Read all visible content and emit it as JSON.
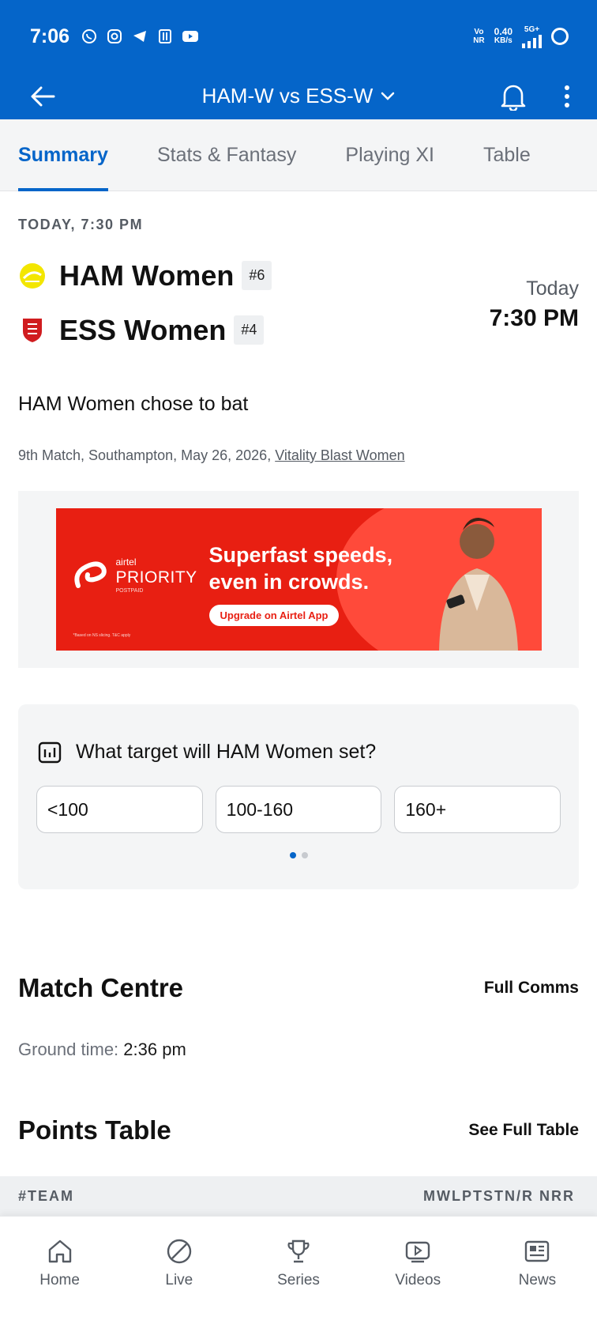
{
  "status_bar": {
    "time": "7:06",
    "volte_top": "Vo",
    "volte_bottom": "NR",
    "speed_value": "0.40",
    "speed_unit": "KB/s",
    "network": "5G+"
  },
  "header": {
    "title": "HAM-W vs ESS-W"
  },
  "tabs": [
    {
      "label": "Summary",
      "active": true
    },
    {
      "label": "Stats & Fantasy",
      "active": false
    },
    {
      "label": "Playing XI",
      "active": false
    },
    {
      "label": "Table",
      "active": false
    }
  ],
  "match": {
    "datetime_label": "TODAY, 7:30 PM",
    "team1": {
      "name": "HAM Women",
      "rank": "#6"
    },
    "team2": {
      "name": "ESS Women",
      "rank": "#4"
    },
    "start_day": "Today",
    "start_time": "7:30 PM",
    "toss": "HAM Women chose to bat",
    "meta_text": "9th Match, Southampton, May 26, 2026, ",
    "series_link": "Vitality Blast Women"
  },
  "ad": {
    "brand_small": "airtel",
    "brand_main": "PRIORITY",
    "brand_sub": "POSTPAID",
    "headline_1": "Superfast speeds,",
    "headline_2": "even in crowds.",
    "cta": "Upgrade on Airtel App",
    "disclaimer": "*Based on NS slicing. T&C apply"
  },
  "poll": {
    "question": "What target will HAM Women set?",
    "options": [
      "<100",
      "100-160",
      "160+"
    ],
    "page_count": 2,
    "active_page": 1
  },
  "match_centre": {
    "title": "Match Centre",
    "link": "Full Comms",
    "ground_label": "Ground time:",
    "ground_value": "2:36 pm"
  },
  "points_table": {
    "title": "Points Table",
    "link": "See Full Table",
    "col_team": "#TEAM",
    "col_stats": "MWLPTSTN/R NRR"
  },
  "bottom_nav": [
    {
      "label": "Home",
      "icon": "home-icon"
    },
    {
      "label": "Live",
      "icon": "live-icon"
    },
    {
      "label": "Series",
      "icon": "trophy-icon"
    },
    {
      "label": "Videos",
      "icon": "video-icon"
    },
    {
      "label": "News",
      "icon": "news-icon"
    }
  ],
  "colors": {
    "brand_blue": "#0565c9",
    "ad_red": "#e81f12"
  }
}
